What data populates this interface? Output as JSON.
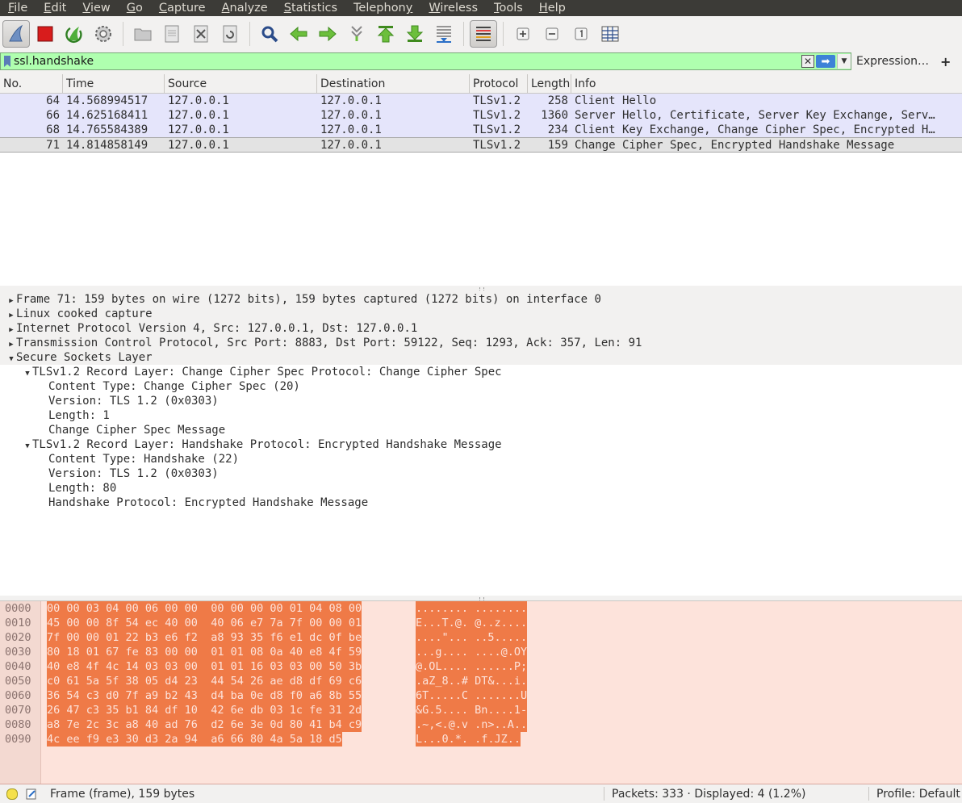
{
  "menu": [
    "File",
    "Edit",
    "View",
    "Go",
    "Capture",
    "Analyze",
    "Statistics",
    "Telephony",
    "Wireless",
    "Tools",
    "Help"
  ],
  "menu_mnemonic": [
    "F",
    "E",
    "V",
    "G",
    "C",
    "A",
    "S",
    "y",
    "W",
    "T",
    "H"
  ],
  "toolbar_icons": [
    "shark-fin-icon",
    "stop-icon",
    "restart-icon",
    "gear-icon",
    "open-icon",
    "save-icon",
    "close-file-icon",
    "reload-icon",
    "search-icon",
    "back-icon",
    "forward-icon",
    "goto-icon",
    "first-icon",
    "last-icon",
    "autoscroll-icon",
    "colorize-icon",
    "zoom-in-icon",
    "zoom-out-icon",
    "zoom-reset-icon",
    "resize-columns-icon"
  ],
  "filter": {
    "value": "ssl.handshake",
    "clear_glyph": "✕",
    "apply_glyph": "➡",
    "dropdown_glyph": "▼",
    "expression_label": "Expression…",
    "add_glyph": "+",
    "bg_color": "#afffaf"
  },
  "packet_list": {
    "columns": [
      "No.",
      "Time",
      "Source",
      "Destination",
      "Protocol",
      "Length",
      "Info"
    ],
    "rows": [
      {
        "no": "64",
        "time": "14.568994517",
        "src": "127.0.0.1",
        "dst": "127.0.0.1",
        "proto": "TLSv1.2",
        "len": "258",
        "info": "Client Hello"
      },
      {
        "no": "66",
        "time": "14.625168411",
        "src": "127.0.0.1",
        "dst": "127.0.0.1",
        "proto": "TLSv1.2",
        "len": "1360",
        "info": "Server Hello, Certificate, Server Key Exchange, Serv…"
      },
      {
        "no": "68",
        "time": "14.765584389",
        "src": "127.0.0.1",
        "dst": "127.0.0.1",
        "proto": "TLSv1.2",
        "len": "234",
        "info": "Client Key Exchange, Change Cipher Spec, Encrypted H…"
      },
      {
        "no": "71",
        "time": "14.814858149",
        "src": "127.0.0.1",
        "dst": "127.0.0.1",
        "proto": "TLSv1.2",
        "len": "159",
        "info": "Change Cipher Spec, Encrypted Handshake Message"
      }
    ],
    "selected_no": "71",
    "tls_row_color": "#e5e5fb"
  },
  "detail_tree": [
    {
      "level": 0,
      "expanded": false,
      "text": "Frame 71: 159 bytes on wire (1272 bits), 159 bytes captured (1272 bits) on interface 0"
    },
    {
      "level": 0,
      "expanded": false,
      "text": "Linux cooked capture"
    },
    {
      "level": 0,
      "expanded": false,
      "text": "Internet Protocol Version 4, Src: 127.0.0.1, Dst: 127.0.0.1"
    },
    {
      "level": 0,
      "expanded": false,
      "text": "Transmission Control Protocol, Src Port: 8883, Dst Port: 59122, Seq: 1293, Ack: 357, Len: 91"
    },
    {
      "level": 0,
      "expanded": true,
      "text": "Secure Sockets Layer"
    },
    {
      "level": 1,
      "expanded": true,
      "text": "TLSv1.2 Record Layer: Change Cipher Spec Protocol: Change Cipher Spec"
    },
    {
      "level": 2,
      "expanded": null,
      "text": "Content Type: Change Cipher Spec (20)"
    },
    {
      "level": 2,
      "expanded": null,
      "text": "Version: TLS 1.2 (0x0303)"
    },
    {
      "level": 2,
      "expanded": null,
      "text": "Length: 1"
    },
    {
      "level": 2,
      "expanded": null,
      "text": "Change Cipher Spec Message"
    },
    {
      "level": 1,
      "expanded": true,
      "text": "TLSv1.2 Record Layer: Handshake Protocol: Encrypted Handshake Message"
    },
    {
      "level": 2,
      "expanded": null,
      "text": "Content Type: Handshake (22)"
    },
    {
      "level": 2,
      "expanded": null,
      "text": "Version: TLS 1.2 (0x0303)"
    },
    {
      "level": 2,
      "expanded": null,
      "text": "Length: 80"
    },
    {
      "level": 2,
      "expanded": null,
      "text": "Handshake Protocol: Encrypted Handshake Message"
    }
  ],
  "bytes": [
    {
      "off": "0000",
      "hex": "00 00 03 04 00 06 00 00  00 00 00 00 01 04 08 00",
      "ascii": "........ ........"
    },
    {
      "off": "0010",
      "hex": "45 00 00 8f 54 ec 40 00  40 06 e7 7a 7f 00 00 01",
      "ascii": "E...T.@. @..z...."
    },
    {
      "off": "0020",
      "hex": "7f 00 00 01 22 b3 e6 f2  a8 93 35 f6 e1 dc 0f be",
      "ascii": "....\"... ..5....."
    },
    {
      "off": "0030",
      "hex": "80 18 01 67 fe 83 00 00  01 01 08 0a 40 e8 4f 59",
      "ascii": "...g.... ....@.OY"
    },
    {
      "off": "0040",
      "hex": "40 e8 4f 4c 14 03 03 00  01 01 16 03 03 00 50 3b",
      "ascii": "@.OL.... ......P;"
    },
    {
      "off": "0050",
      "hex": "c0 61 5a 5f 38 05 d4 23  44 54 26 ae d8 df 69 c6",
      "ascii": ".aZ_8..# DT&...i."
    },
    {
      "off": "0060",
      "hex": "36 54 c3 d0 7f a9 b2 43  d4 ba 0e d8 f0 a6 8b 55",
      "ascii": "6T.....C .......U"
    },
    {
      "off": "0070",
      "hex": "26 47 c3 35 b1 84 df 10  42 6e db 03 1c fe 31 2d",
      "ascii": "&G.5.... Bn....1-"
    },
    {
      "off": "0080",
      "hex": "a8 7e 2c 3c a8 40 ad 76  d2 6e 3e 0d 80 41 b4 c9",
      "ascii": ".~,<.@.v .n>..A.."
    },
    {
      "off": "0090",
      "hex": "4c ee f9 e3 30 d3 2a 94  a6 66 80 4a 5a 18 d5",
      "ascii": "L...0.*. .f.JZ.."
    }
  ],
  "status": {
    "frame": "Frame (frame), 159 bytes",
    "packets": "Packets: 333 · Displayed: 4 (1.2%)",
    "profile": "Profile: Default"
  },
  "colors": {
    "highlight": "#ef7a47",
    "bytes_bg": "#fde3db",
    "menubar_bg": "#3c3b37"
  }
}
